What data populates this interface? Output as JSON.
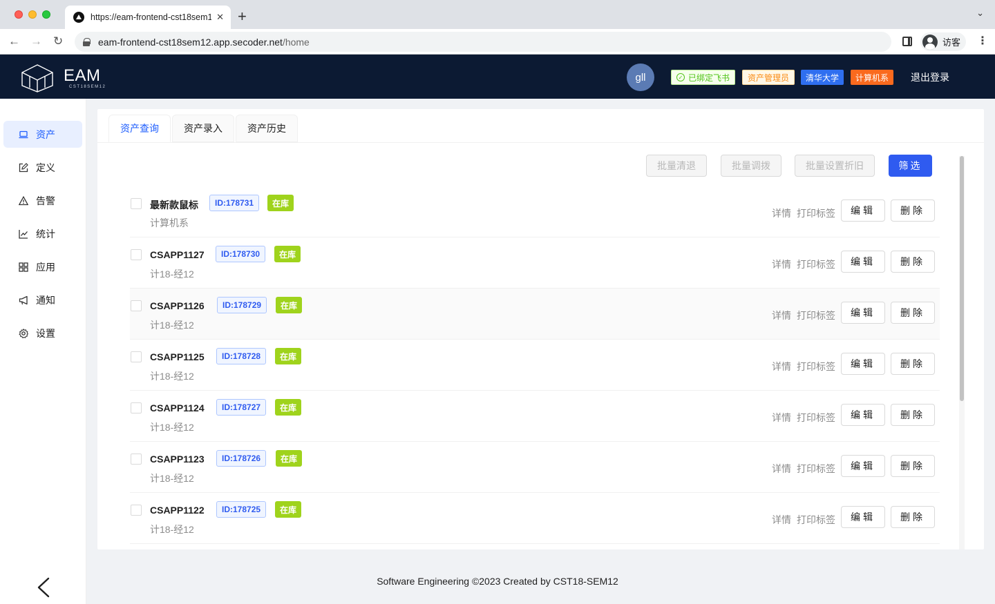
{
  "browser": {
    "tab_title": "https://eam-frontend-cst18sem12.app.secoder.net/home",
    "url_host": "eam-frontend-cst18sem12.app.secoder.net",
    "url_path": "/home",
    "profile_name": "访客"
  },
  "header": {
    "logo_main": "EAM",
    "logo_sub": "CST18SEM12",
    "avatar_text": "gll",
    "tags": {
      "feishu": "已绑定飞书",
      "role": "资产管理员",
      "school": "清华大学",
      "dept": "计算机系"
    },
    "logout": "退出登录"
  },
  "sidebar": {
    "items": [
      {
        "label": "资产",
        "icon": "laptop-icon",
        "active": true
      },
      {
        "label": "定义",
        "icon": "edit-icon",
        "active": false
      },
      {
        "label": "告警",
        "icon": "warning-icon",
        "active": false
      },
      {
        "label": "统计",
        "icon": "line-chart-icon",
        "active": false
      },
      {
        "label": "应用",
        "icon": "appstore-icon",
        "active": false
      },
      {
        "label": "通知",
        "icon": "notification-icon",
        "active": false
      },
      {
        "label": "设置",
        "icon": "setting-icon",
        "active": false
      }
    ],
    "collapse_icon": "chevron-left-icon"
  },
  "main": {
    "tabs": [
      {
        "label": "资产查询",
        "active": true
      },
      {
        "label": "资产录入",
        "active": false
      },
      {
        "label": "资产历史",
        "active": false
      }
    ],
    "batch": {
      "clear": "批量清退",
      "transfer": "批量调拨",
      "depreciation": "批量设置折旧",
      "filter": "筛选"
    },
    "actions": {
      "detail": "详情",
      "print": "打印标签",
      "edit": "编辑",
      "delete": "删除"
    },
    "assets": [
      {
        "name": "最新款鼠标",
        "id": "ID:178731",
        "status": "在库",
        "dept": "计算机系"
      },
      {
        "name": "CSAPP1127",
        "id": "ID:178730",
        "status": "在库",
        "dept": "计18-经12"
      },
      {
        "name": "CSAPP1126",
        "id": "ID:178729",
        "status": "在库",
        "dept": "计18-经12"
      },
      {
        "name": "CSAPP1125",
        "id": "ID:178728",
        "status": "在库",
        "dept": "计18-经12"
      },
      {
        "name": "CSAPP1124",
        "id": "ID:178727",
        "status": "在库",
        "dept": "计18-经12"
      },
      {
        "name": "CSAPP1123",
        "id": "ID:178726",
        "status": "在库",
        "dept": "计18-经12"
      },
      {
        "name": "CSAPP1122",
        "id": "ID:178725",
        "status": "在库",
        "dept": "计18-经12"
      }
    ]
  },
  "footer": "Software Engineering ©2023 Created by CST18-SEM12",
  "colors": {
    "header_bg": "#0c1a33",
    "accent": "#2f5bf0",
    "status_green": "#9fd31c",
    "dept_tag": "#fa6a1e"
  }
}
